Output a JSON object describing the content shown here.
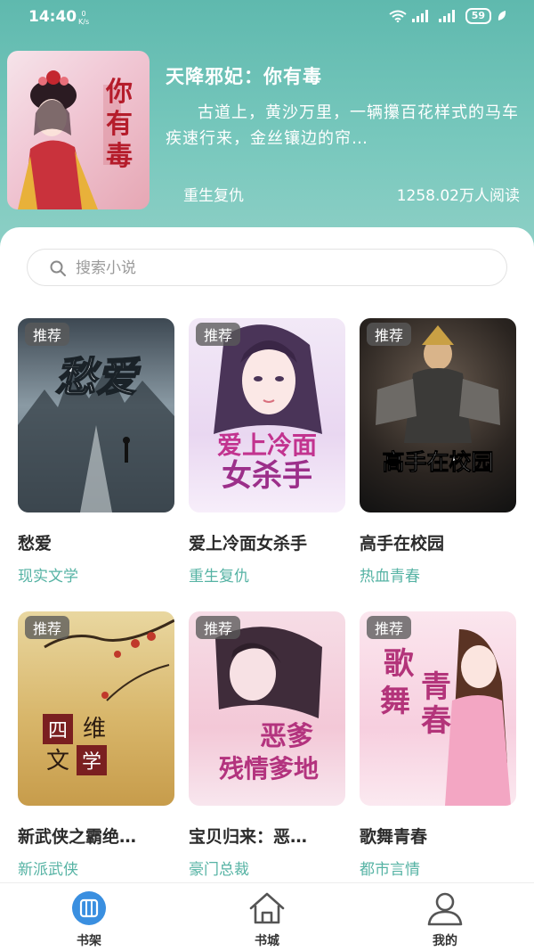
{
  "status_bar": {
    "time": "14:40",
    "net_speed_value": "0",
    "net_speed_unit": "K/s",
    "battery": "59"
  },
  "featured": {
    "title": "天降邪妃：你有毒",
    "description": "古道上，黄沙万里，一辆攥百花样式的马车疾速行来，金丝镶边的帘…",
    "genre": "重生复仇",
    "reads": "1258.02万人阅读",
    "cover_text": "你有毒"
  },
  "search": {
    "placeholder": "搜索小说"
  },
  "books": [
    {
      "tag": "推荐",
      "title": "愁爱",
      "genre": "现实文学",
      "cover_text": "愁爱"
    },
    {
      "tag": "推荐",
      "title": "爱上冷面女杀手",
      "genre": "重生复仇",
      "cover_text": "爱上冷面女杀手"
    },
    {
      "tag": "推荐",
      "title": "高手在校园",
      "genre": "热血青春",
      "cover_text": "高手在校园"
    },
    {
      "tag": "推荐",
      "title": "新武侠之霸绝…",
      "genre": "新派武侠",
      "cover_text": "四维文学"
    },
    {
      "tag": "推荐",
      "title": "宝贝归来：恶…",
      "genre": "豪门总裁",
      "cover_text": "恶爹残情爹地"
    },
    {
      "tag": "推荐",
      "title": "歌舞青春",
      "genre": "都市言情",
      "cover_text": "歌舞青春"
    }
  ],
  "tabs": [
    {
      "label": "书架",
      "icon": "bookshelf-icon",
      "active": true
    },
    {
      "label": "书城",
      "icon": "home-icon",
      "active": false
    },
    {
      "label": "我的",
      "icon": "user-icon",
      "active": false
    }
  ],
  "colors": {
    "hero": "#6fc2b7",
    "accent": "#3a8fe0",
    "genre_text": "#56b3a4",
    "tag_bg": "#5a5a5a"
  }
}
